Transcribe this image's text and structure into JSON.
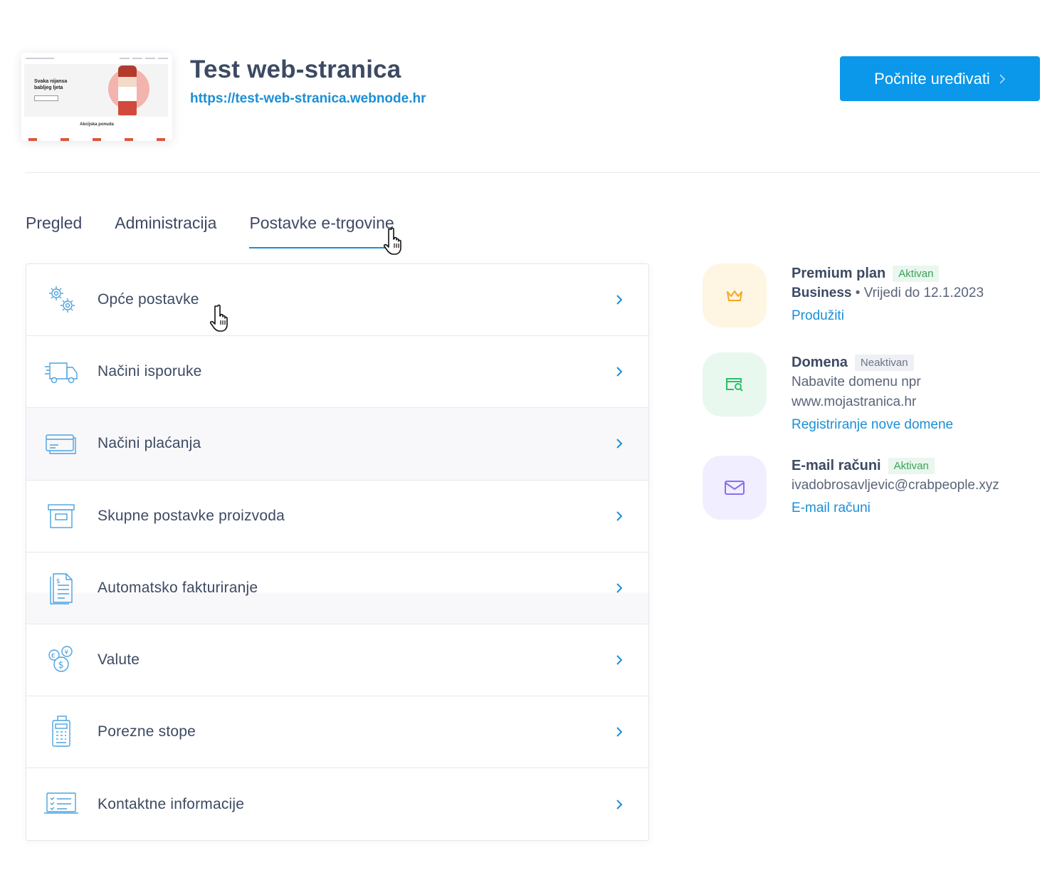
{
  "header": {
    "site_title": "Test web-stranica",
    "site_url": "https://test-web-stranica.webnode.hr",
    "edit_button": "Počnite uređivati",
    "thumbnail": {
      "hero_text_1": "Svaka nijansa",
      "hero_text_2": "babljeg ljeta",
      "section_title": "Akcijska ponuda"
    }
  },
  "tabs": [
    {
      "label": "Pregled"
    },
    {
      "label": "Administracija"
    },
    {
      "label": "Postavke e-trgovine",
      "active": true
    }
  ],
  "settings": [
    {
      "label": "Opće postavke",
      "icon": "gears-icon"
    },
    {
      "label": "Načini isporuke",
      "icon": "delivery-truck-icon"
    },
    {
      "label": "Načini plaćanja",
      "icon": "payment-cards-icon"
    },
    {
      "label": "Skupne postavke proizvoda",
      "icon": "product-box-icon"
    },
    {
      "label": "Automatsko fakturiranje",
      "icon": "invoice-icon"
    },
    {
      "label": "Valute",
      "icon": "currency-coins-icon"
    },
    {
      "label": "Porezne stope",
      "icon": "calculator-icon"
    },
    {
      "label": "Kontaktne informacije",
      "icon": "contact-laptop-icon"
    }
  ],
  "services": {
    "premium": {
      "title": "Premium plan",
      "status": "Aktivan",
      "plan": "Business",
      "valid": "• Vrijedi do 12.1.2023",
      "link": "Produžiti",
      "icon": "crown-icon",
      "bg": "#fff5e3",
      "color": "#f5a623"
    },
    "domain": {
      "title": "Domena",
      "status": "Neaktivan",
      "line1": "Nabavite domenu npr",
      "line2": "www.mojastranica.hr",
      "link": "Registriranje nove domene",
      "icon": "domain-search-icon",
      "bg": "#e9f8ef",
      "color": "#2cbf67"
    },
    "email": {
      "title": "E-mail računi",
      "status": "Aktivan",
      "address": "ivadobrosavljevic@crabpeople.xyz",
      "link": "E-mail računi",
      "icon": "envelope-icon",
      "bg": "#f1efff",
      "color": "#8a6df0"
    }
  },
  "colors": {
    "accent": "#0b97ea",
    "link": "#1a8fd6",
    "text": "#3d4a63"
  }
}
